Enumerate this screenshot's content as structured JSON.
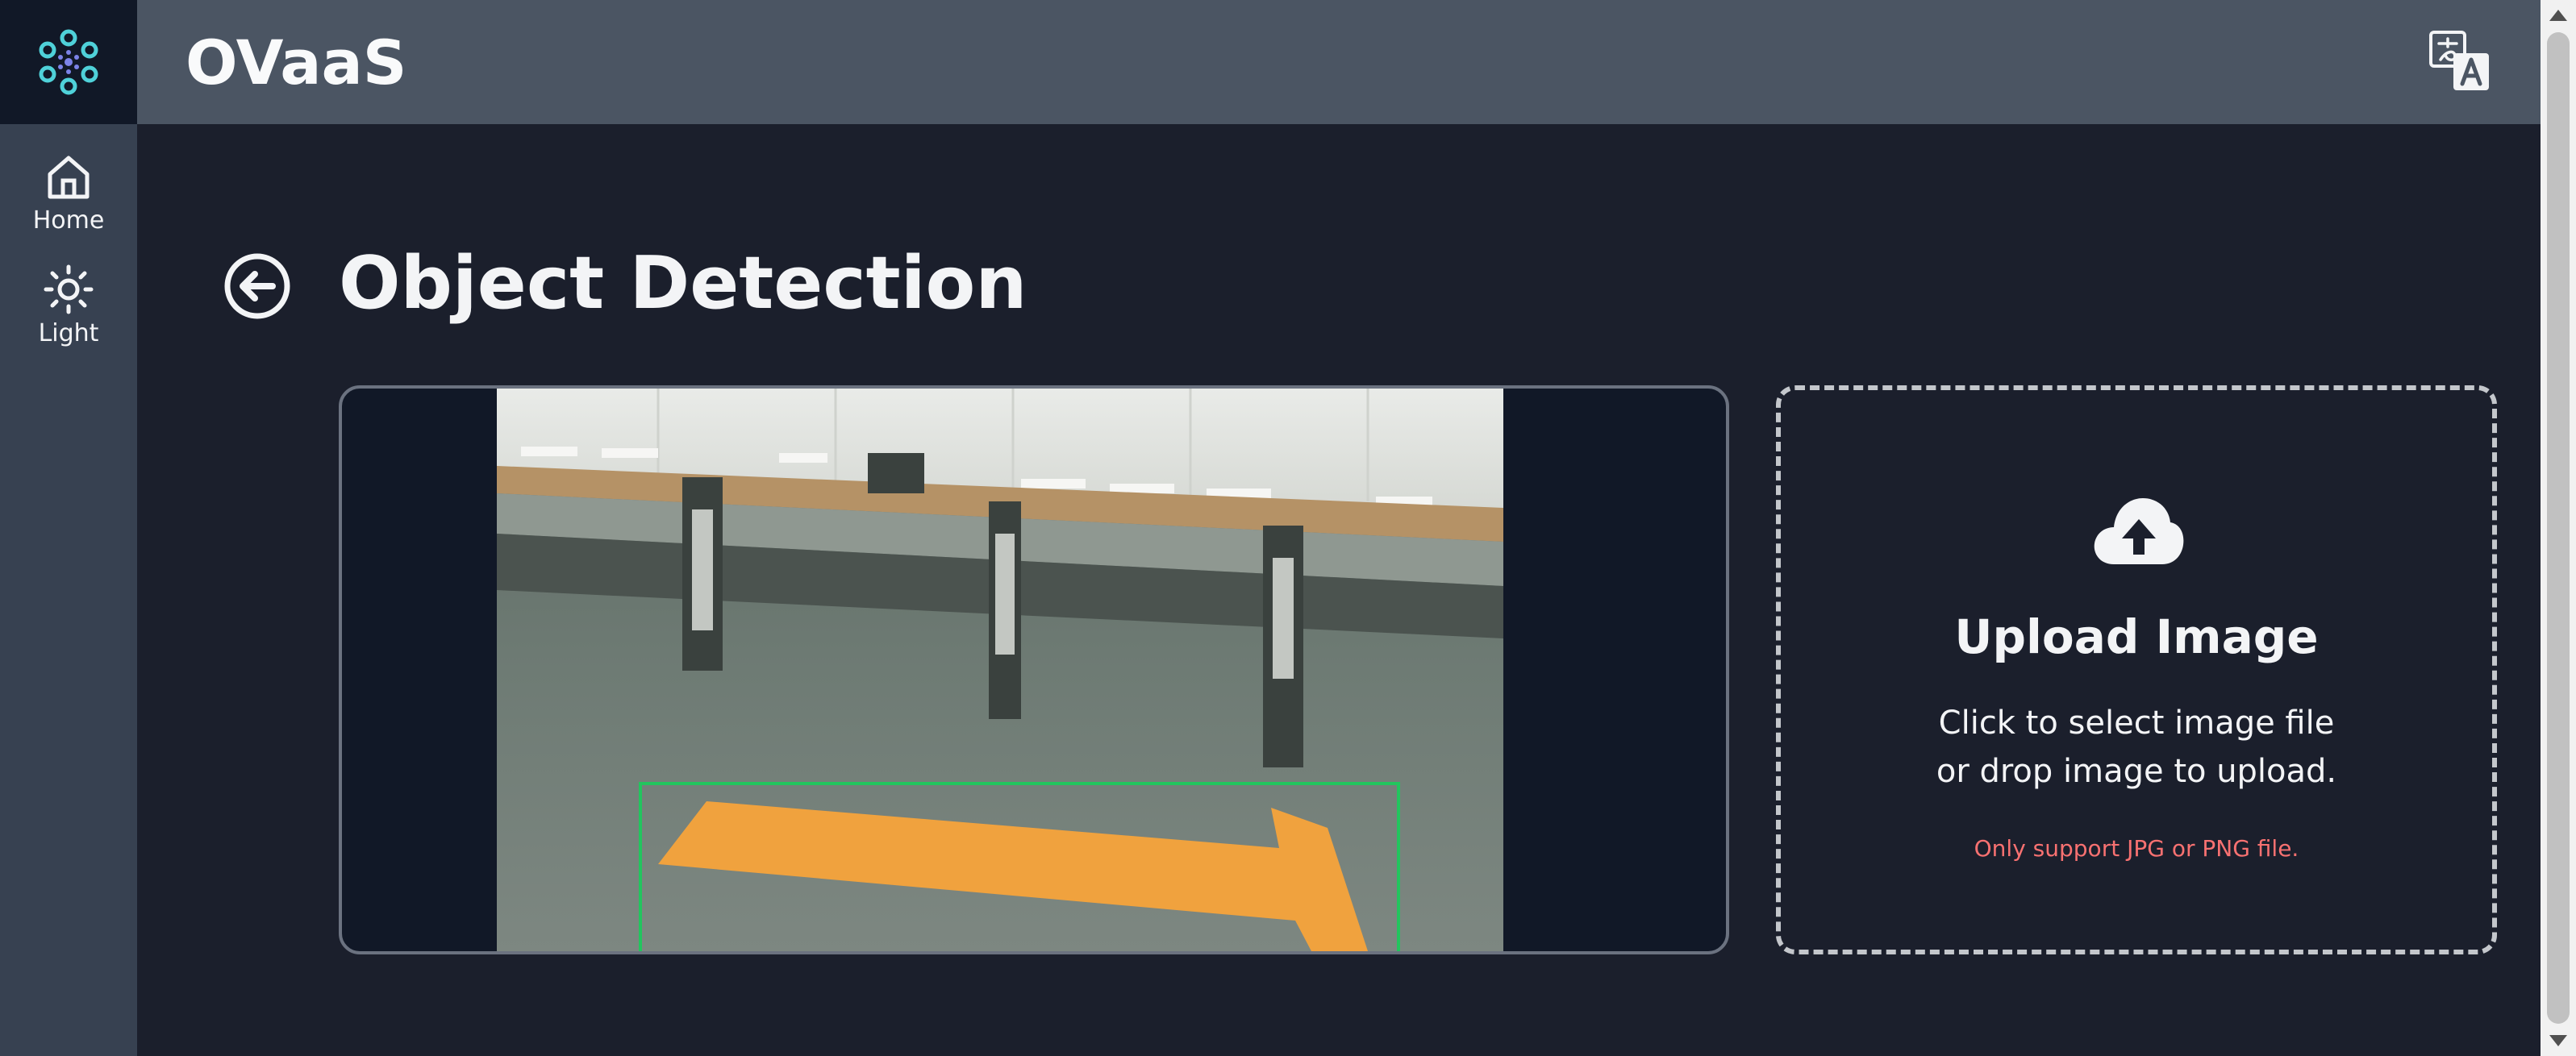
{
  "app": {
    "title": "OVaaS"
  },
  "sidebar": {
    "items": [
      {
        "label": "Home",
        "icon": "home-icon"
      },
      {
        "label": "Light",
        "icon": "sun-icon"
      }
    ]
  },
  "page": {
    "title": "Object Detection"
  },
  "upload": {
    "title": "Upload Image",
    "line1": "Click to select image file",
    "line2": "or drop image to upload.",
    "note": "Only support JPG or PNG file."
  },
  "colors": {
    "sidebar": "#374151",
    "topbar": "#4b5563",
    "background": "#1b1f2c",
    "detection_box": "#22c55e",
    "note": "#f87171"
  }
}
